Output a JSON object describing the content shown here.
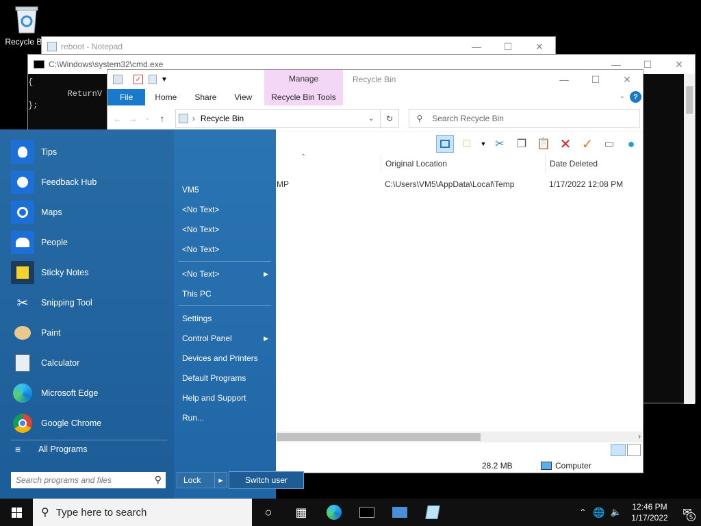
{
  "desktop": {
    "recycle_label": "Recycle Bin"
  },
  "notepad": {
    "title": "reboot - Notepad"
  },
  "cmd": {
    "title": "C:\\Windows\\system32\\cmd.exe",
    "lines": [
      "{",
      "        ReturnV",
      "};"
    ]
  },
  "explorer": {
    "title": "Recycle Bin",
    "manage": "Manage",
    "tabs": {
      "file": "File",
      "home": "Home",
      "share": "Share",
      "view": "View",
      "tools": "Recycle Bin Tools"
    },
    "address": "Recycle Bin",
    "search_placeholder": "Search Recycle Bin",
    "columns": {
      "original_location": "Original Location",
      "date_deleted": "Date Deleted"
    },
    "row": {
      "name_tail": "MP",
      "location": "C:\\Users\\VM5\\AppData\\Local\\Temp",
      "date": "1/17/2022 12:08 PM"
    },
    "status": {
      "size": "28.2 MB",
      "computer": "Computer"
    }
  },
  "startmenu": {
    "apps": [
      "Tips",
      "Feedback Hub",
      "Maps",
      "People",
      "Sticky Notes",
      "Snipping Tool",
      "Paint",
      "Calculator",
      "Microsoft Edge",
      "Google Chrome"
    ],
    "all_programs": "All Programs",
    "search_placeholder": "Search programs and files",
    "right": {
      "user": "VM5",
      "no_text_1": "<No Text>",
      "no_text_2": "<No Text>",
      "no_text_3": "<No Text>",
      "no_text_4": "<No Text>",
      "this_pc": "This PC",
      "settings": "Settings",
      "control_panel": "Control Panel",
      "devices": "Devices and Printers",
      "default_programs": "Default Programs",
      "help": "Help and Support",
      "run": "Run..."
    },
    "lock": "Lock",
    "switch_user": "Switch user"
  },
  "taskbar": {
    "search_placeholder": "Type here to search",
    "time": "12:46 PM",
    "date": "1/17/2022",
    "notifications": "5"
  },
  "colors": {
    "start_bg": "#2b74b3",
    "file_tab": "#1979ca",
    "manage_tab": "#f4d7f7"
  }
}
